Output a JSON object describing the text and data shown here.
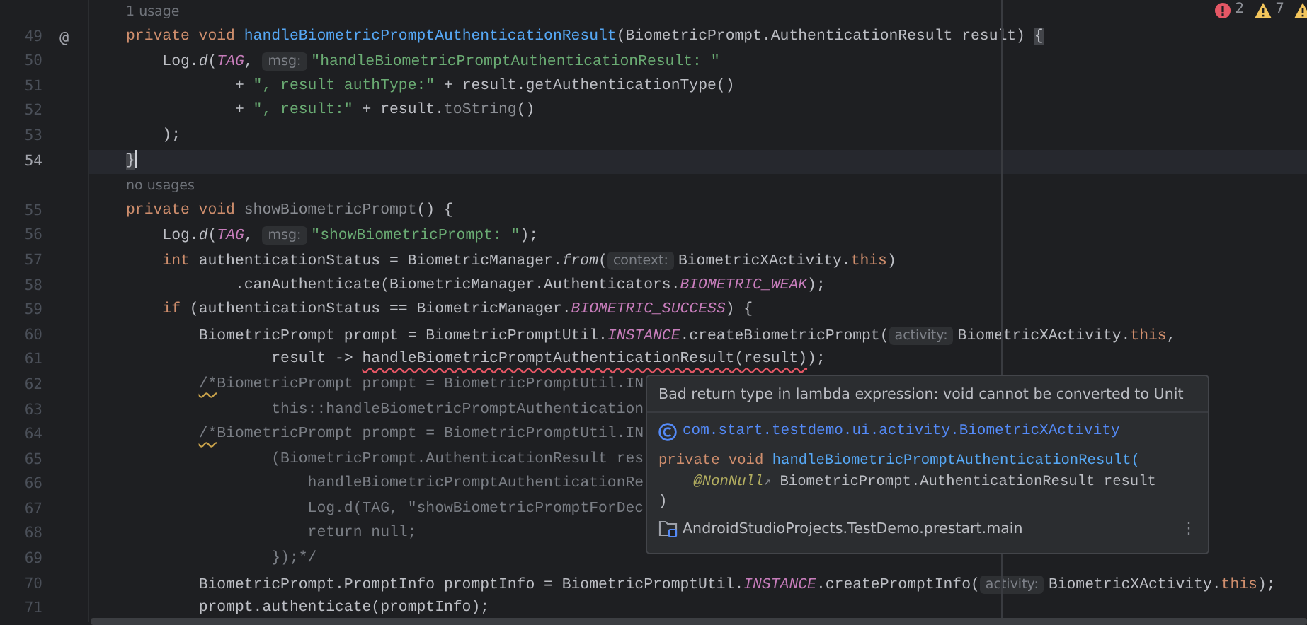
{
  "editor": {
    "inspections": [
      {
        "kind": "error",
        "count": "2"
      },
      {
        "kind": "warning",
        "count": "7"
      },
      {
        "kind": "warning"
      }
    ],
    "lines": [
      {
        "kind": "usage",
        "text": "1 usage"
      },
      {
        "kind": "code",
        "number": "49",
        "mark": "@",
        "current": false,
        "tokens": [
          {
            "kind": "kw",
            "text": "private void "
          },
          {
            "kind": "decl",
            "text": "handleBiometricPromptAuthenticationResult"
          },
          {
            "kind": "plain",
            "text": "(BiometricPrompt.AuthenticationResult result) "
          },
          {
            "kind": "match",
            "text": "{"
          }
        ]
      },
      {
        "kind": "code",
        "number": "50",
        "current": false,
        "tokens": [
          {
            "kind": "plain",
            "text": "    Log."
          },
          {
            "kind": "static",
            "text": "d"
          },
          {
            "kind": "plain",
            "text": "("
          },
          {
            "kind": "const",
            "text": "TAG"
          },
          {
            "kind": "plain",
            "text": ", "
          },
          {
            "kind": "hint",
            "text": "msg:"
          },
          {
            "kind": "str",
            "text": "\"handleBiometricPromptAuthenticationResult: \""
          }
        ]
      },
      {
        "kind": "code",
        "number": "51",
        "current": false,
        "tokens": [
          {
            "kind": "plain",
            "text": "            + "
          },
          {
            "kind": "str",
            "text": "\", result authType:\""
          },
          {
            "kind": "plain",
            "text": " + result.getAuthenticationType()"
          }
        ]
      },
      {
        "kind": "code",
        "number": "52",
        "current": false,
        "tokens": [
          {
            "kind": "plain",
            "text": "            + "
          },
          {
            "kind": "str",
            "text": "\", result:\""
          },
          {
            "kind": "plain",
            "text": " + result."
          },
          {
            "kind": "dim",
            "text": "toString"
          },
          {
            "kind": "plain",
            "text": "()"
          }
        ]
      },
      {
        "kind": "code",
        "number": "53",
        "current": false,
        "tokens": [
          {
            "kind": "plain",
            "text": "    );"
          }
        ]
      },
      {
        "kind": "code",
        "number": "54",
        "current": true,
        "tokens": [
          {
            "kind": "match",
            "text": "}"
          }
        ]
      },
      {
        "kind": "usage",
        "text": "no usages"
      },
      {
        "kind": "code",
        "number": "55",
        "current": false,
        "tokens": [
          {
            "kind": "kw",
            "text": "private void "
          },
          {
            "kind": "dim",
            "text": "showBiometricPrompt"
          },
          {
            "kind": "plain",
            "text": "() {"
          }
        ]
      },
      {
        "kind": "code",
        "number": "56",
        "current": false,
        "tokens": [
          {
            "kind": "plain",
            "text": "    Log."
          },
          {
            "kind": "static",
            "text": "d"
          },
          {
            "kind": "plain",
            "text": "("
          },
          {
            "kind": "const",
            "text": "TAG"
          },
          {
            "kind": "plain",
            "text": ", "
          },
          {
            "kind": "hint",
            "text": "msg:"
          },
          {
            "kind": "str",
            "text": "\"showBiometricPrompt: \""
          },
          {
            "kind": "plain",
            "text": ");"
          }
        ]
      },
      {
        "kind": "code",
        "number": "57",
        "current": false,
        "tokens": [
          {
            "kind": "kw",
            "text": "    int "
          },
          {
            "kind": "plain",
            "text": "authenticationStatus = BiometricManager."
          },
          {
            "kind": "static",
            "text": "from"
          },
          {
            "kind": "plain",
            "text": "("
          },
          {
            "kind": "hint",
            "text": "context:"
          },
          {
            "kind": "plain",
            "text": "BiometricXActivity."
          },
          {
            "kind": "kw",
            "text": "this"
          },
          {
            "kind": "plain",
            "text": ")"
          }
        ]
      },
      {
        "kind": "code",
        "number": "58",
        "current": false,
        "tokens": [
          {
            "kind": "plain",
            "text": "            .canAuthenticate(BiometricManager.Authenticators."
          },
          {
            "kind": "const",
            "text": "BIOMETRIC_WEAK"
          },
          {
            "kind": "plain",
            "text": ");"
          }
        ]
      },
      {
        "kind": "code",
        "number": "59",
        "current": false,
        "tokens": [
          {
            "kind": "kw",
            "text": "    if "
          },
          {
            "kind": "plain",
            "text": "(authenticationStatus == BiometricManager."
          },
          {
            "kind": "const",
            "text": "BIOMETRIC_SUCCESS"
          },
          {
            "kind": "plain",
            "text": ") {"
          }
        ]
      },
      {
        "kind": "code",
        "number": "60",
        "current": false,
        "tokens": [
          {
            "kind": "plain",
            "text": "        BiometricPrompt prompt = BiometricPromptUtil."
          },
          {
            "kind": "const",
            "text": "INSTANCE"
          },
          {
            "kind": "plain",
            "text": ".createBiometricPrompt("
          },
          {
            "kind": "hint",
            "text": "activity:"
          },
          {
            "kind": "plain",
            "text": "BiometricXActivity."
          },
          {
            "kind": "kw",
            "text": "this"
          },
          {
            "kind": "plain",
            "text": ","
          }
        ]
      },
      {
        "kind": "code",
        "number": "61",
        "current": false,
        "tokens": [
          {
            "kind": "plain",
            "text": "                result -> "
          },
          {
            "kind": "error",
            "text": "handleBiometricPromptAuthenticationResult(result)"
          },
          {
            "kind": "plain",
            "text": ");"
          }
        ]
      },
      {
        "kind": "code",
        "number": "62",
        "current": false,
        "tokens": [
          {
            "kind": "warn_comment",
            "text": "        /*"
          },
          {
            "kind": "comment",
            "text": "BiometricPrompt prompt = BiometricPromptUtil.IN"
          }
        ]
      },
      {
        "kind": "code",
        "number": "63",
        "current": false,
        "tokens": [
          {
            "kind": "comment",
            "text": "                this::handleBiometricPromptAuthentication"
          }
        ]
      },
      {
        "kind": "code",
        "number": "64",
        "current": false,
        "tokens": [
          {
            "kind": "warn_comment",
            "text": "        /*"
          },
          {
            "kind": "comment",
            "text": "BiometricPrompt prompt = BiometricPromptUtil.IN"
          }
        ]
      },
      {
        "kind": "code",
        "number": "65",
        "current": false,
        "tokens": [
          {
            "kind": "comment",
            "text": "                (BiometricPrompt.AuthenticationResult res"
          }
        ]
      },
      {
        "kind": "code",
        "number": "66",
        "current": false,
        "tokens": [
          {
            "kind": "comment",
            "text": "                    handleBiometricPromptAuthenticationRe"
          }
        ]
      },
      {
        "kind": "code",
        "number": "67",
        "current": false,
        "tokens": [
          {
            "kind": "comment",
            "text": "                    Log.d(TAG, \"showBiometricPromptForDec"
          }
        ]
      },
      {
        "kind": "code",
        "number": "68",
        "current": false,
        "tokens": [
          {
            "kind": "comment",
            "text": "                    return null;"
          }
        ]
      },
      {
        "kind": "code",
        "number": "69",
        "current": false,
        "tokens": [
          {
            "kind": "comment",
            "text": "                });*/"
          }
        ]
      },
      {
        "kind": "code",
        "number": "70",
        "current": false,
        "tokens": [
          {
            "kind": "plain",
            "text": "        BiometricPrompt.PromptInfo promptInfo = BiometricPromptUtil."
          },
          {
            "kind": "const",
            "text": "INSTANCE"
          },
          {
            "kind": "plain",
            "text": ".createPromptInfo("
          },
          {
            "kind": "hint",
            "text": "activity:"
          },
          {
            "kind": "plain",
            "text": "BiometricXActivity."
          },
          {
            "kind": "kw",
            "text": "this"
          },
          {
            "kind": "plain",
            "text": ");"
          }
        ]
      },
      {
        "kind": "code",
        "number": "71",
        "current": false,
        "tokens": [
          {
            "kind": "plain",
            "text": "        prompt.authenticate(promptInfo);"
          }
        ]
      }
    ],
    "tooltip": {
      "message": "Bad return type in lambda expression: void cannot be converted to Unit",
      "class_name": "com.start.testdemo.ui.activity.BiometricXActivity",
      "signature": [
        [
          {
            "kind": "kw",
            "text": "private void "
          },
          {
            "kind": "decl",
            "text": "handleBiometricPromptAuthenticationResult("
          }
        ],
        [
          {
            "kind": "annotation",
            "text": "    @NonNull"
          },
          {
            "kind": "ext",
            "text": "↗"
          },
          {
            "kind": "plain",
            "text": " BiometricPrompt.AuthenticationResult result"
          }
        ],
        [
          {
            "kind": "plain",
            "text": ")"
          }
        ]
      ],
      "module": "AndroidStudioProjects.TestDemo.prestart.main",
      "menu": "⋮"
    }
  }
}
